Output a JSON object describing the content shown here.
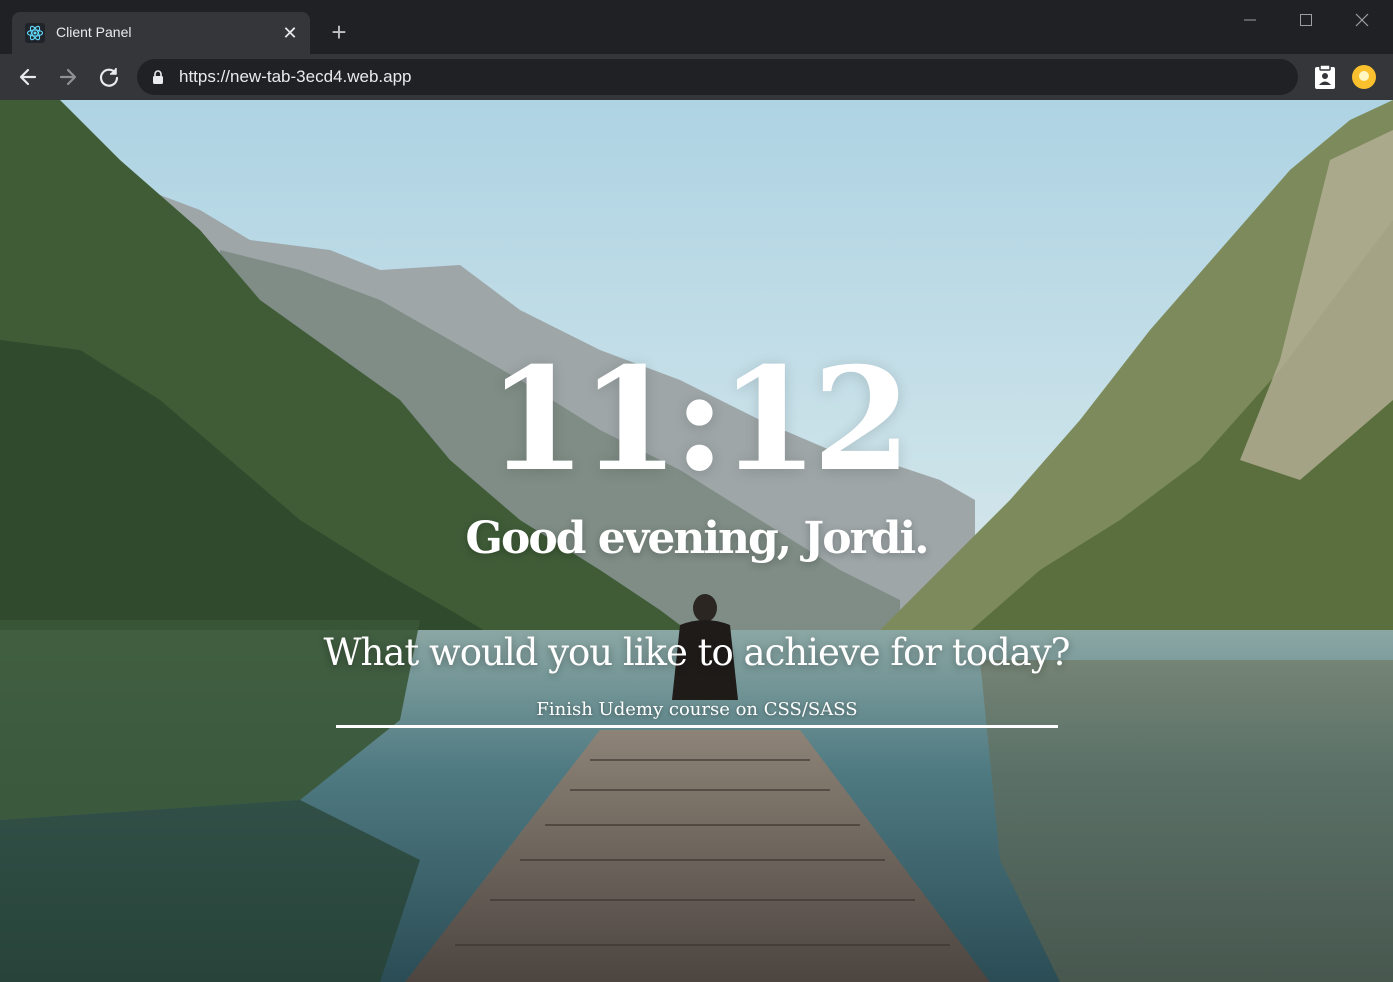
{
  "browser": {
    "tab": {
      "title": "Client Panel",
      "favicon": "react-atom-icon"
    },
    "new_tab_glyph": "+",
    "close_glyph": "✕",
    "url": "https://new-tab-3ecd4.web.app",
    "icons": [
      "arrow-left-icon",
      "arrow-right-icon",
      "reload-icon",
      "lock-icon",
      "clipboard-icon",
      "profile-icon"
    ]
  },
  "page": {
    "time": "11:12",
    "greeting": "Good evening, Jordi.",
    "question": "What would you like to achieve for today?",
    "focus_value": "Finish Udemy course on CSS/SASS"
  },
  "colors": {
    "chrome_dark": "#202124",
    "chrome_tab": "#35363a",
    "text_light": "#e8eaed",
    "profile_accent": "#fbc02d"
  }
}
